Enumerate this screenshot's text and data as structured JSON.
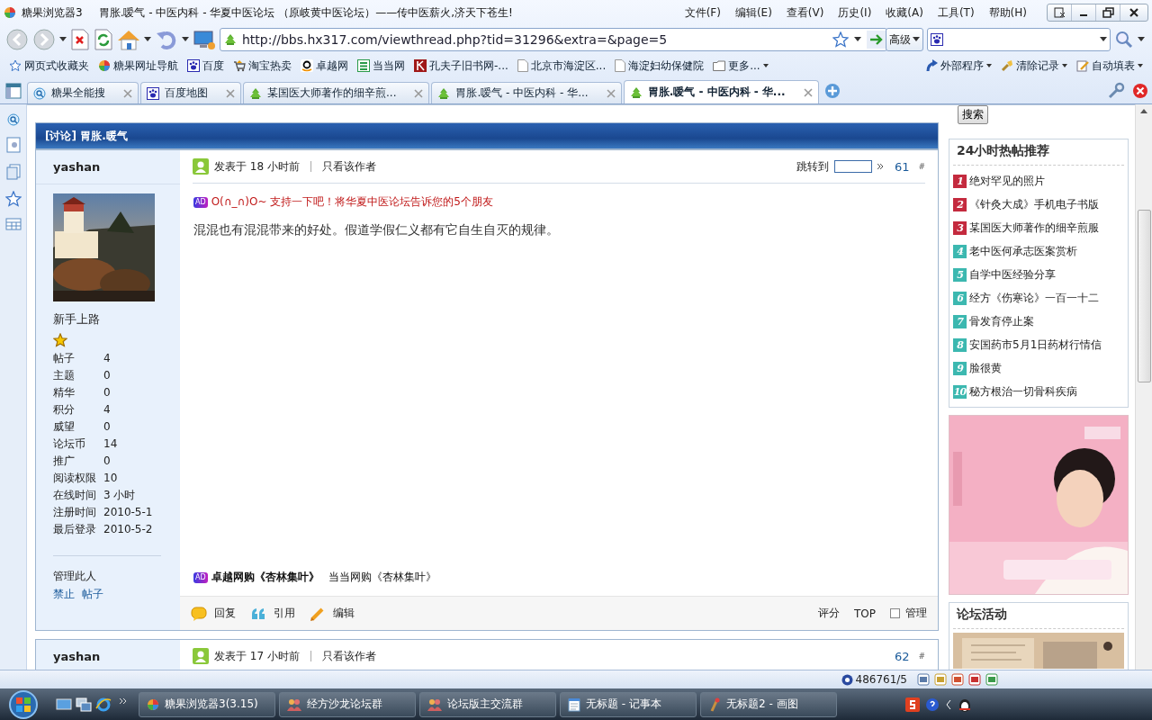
{
  "window": {
    "app_name": "糖果浏览器3",
    "title": "胃胀.嗳气 - 中医内科 - 华夏中医论坛 （原岐黄中医论坛）——传中医薪火,济天下苍生!"
  },
  "menu": [
    "文件(F)",
    "编辑(E)",
    "查看(V)",
    "历史(I)",
    "收藏(A)",
    "工具(T)",
    "帮助(H)"
  ],
  "address_bar": {
    "url": "http://bbs.hx317.com/viewthread.php?tid=31296&extra=&page=5",
    "advanced": "高级"
  },
  "bookmarks": [
    {
      "label": "网页式收藏夹",
      "kind": "star"
    },
    {
      "label": "糖果网址导航",
      "kind": "ball"
    },
    {
      "label": "百度",
      "kind": "paw"
    },
    {
      "label": "淘宝热卖",
      "kind": "cart"
    },
    {
      "label": "卓越网",
      "kind": "amazon"
    },
    {
      "label": "当当网",
      "kind": "green"
    },
    {
      "label": "孔夫子旧书网-...",
      "kind": "red"
    },
    {
      "label": "北京市海淀区...",
      "kind": "page"
    },
    {
      "label": "海淀妇幼保健院",
      "kind": "page"
    },
    {
      "label": "更多...",
      "kind": "folder"
    }
  ],
  "tools": [
    "外部程序",
    "清除记录",
    "自动填表"
  ],
  "tabs": [
    {
      "label": "糖果全能搜",
      "kind": "search",
      "selected": false
    },
    {
      "label": "百度地图",
      "kind": "paw",
      "selected": false
    },
    {
      "label": "某国医大师著作的细辛煎...",
      "kind": "tree",
      "selected": false
    },
    {
      "label": "胃胀.嗳气 - 中医内科 - 华...",
      "kind": "tree",
      "selected": false
    },
    {
      "label": "胃胀.嗳气 - 中医内科 - 华...",
      "kind": "tree",
      "selected": true
    }
  ],
  "thread_title": "[讨论] 胃胀.暖气",
  "posts": [
    {
      "author": "yashan",
      "rank": "新手上路",
      "stats": [
        {
          "label": "帖子",
          "value": "4"
        },
        {
          "label": "主题",
          "value": "0"
        },
        {
          "label": "精华",
          "value": "0"
        },
        {
          "label": "积分",
          "value": "4"
        },
        {
          "label": "威望",
          "value": "0"
        },
        {
          "label": "论坛币",
          "value": "14"
        },
        {
          "label": "推广",
          "value": "0"
        },
        {
          "label": "阅读权限",
          "value": "10"
        },
        {
          "label": "在线时间",
          "value": "3 小时"
        },
        {
          "label": "注册时间",
          "value": "2010-5-1"
        },
        {
          "label": "最后登录",
          "value": "2010-5-2"
        }
      ],
      "manage_label": "管理此人",
      "manage_links": [
        "禁止",
        "帖子"
      ],
      "posted": "发表于  18 小时前",
      "only_author": "只看该作者",
      "jump_label": "跳转到",
      "floor": "61",
      "floor_mark": "#",
      "ad_badge": "AD",
      "ad_line": "O(∩_∩)O~ 支持一下吧！将华夏中医论坛告诉您的5个朋友",
      "body": "混混也有混混带来的好处。假道学假仁义都有它自生自灭的规律。",
      "sig_badge": "AD",
      "sig_links": [
        {
          "text": "卓越网购《杏林集叶》",
          "bold": true
        },
        {
          "text": "当当网购《杏林集叶》",
          "bold": false
        }
      ],
      "actions": [
        {
          "label": "回复",
          "kind": "reply"
        },
        {
          "label": "引用",
          "kind": "quote"
        },
        {
          "label": "编辑",
          "kind": "edit"
        }
      ],
      "right_actions": [
        "评分",
        "TOP"
      ],
      "manage": {
        "label": "管理",
        "checked": false
      }
    },
    {
      "author": "yashan",
      "posted": "发表于  17 小时前",
      "only_author": "只看该作者",
      "floor": "62",
      "floor_mark": "#"
    }
  ],
  "sidebar": {
    "search_button": "搜索",
    "hot": {
      "title": "24小时热帖推荐",
      "items": [
        {
          "rank": "1",
          "text": "绝对罕见的照片",
          "color": "#c42a3e"
        },
        {
          "rank": "2",
          "text": "《针灸大成》手机电子书版",
          "color": "#c42a3e"
        },
        {
          "rank": "3",
          "text": "某国医大师著作的细辛煎服",
          "color": "#c42a3e"
        },
        {
          "rank": "4",
          "text": "老中医何承志医案赏析",
          "color": "#3cb8b0"
        },
        {
          "rank": "5",
          "text": "自学中医经验分享",
          "color": "#3cb8b0"
        },
        {
          "rank": "6",
          "text": "经方《伤寒论》一百一十二",
          "color": "#3cb8b0"
        },
        {
          "rank": "7",
          "text": "骨发育停止案",
          "color": "#3cb8b0"
        },
        {
          "rank": "8",
          "text": "安国药市5月1日药材行情信",
          "color": "#3cb8b0"
        },
        {
          "rank": "9",
          "text": "脸很黄",
          "color": "#3cb8b0"
        },
        {
          "rank": "10",
          "text": "秘方根治一切骨科疾病",
          "color": "#3cb8b0"
        }
      ]
    },
    "activity_title": "论坛活动"
  },
  "status_bar": {
    "counter": "486761/5"
  },
  "taskbar": [
    {
      "label": "糖果浏览器3(3.15)",
      "kind": "browser"
    },
    {
      "label": "经方沙龙论坛群",
      "kind": "people"
    },
    {
      "label": "论坛版主交流群",
      "kind": "people"
    },
    {
      "label": "无标题 - 记事本",
      "kind": "notepad"
    },
    {
      "label": "无标题2 - 画图",
      "kind": "paint"
    }
  ]
}
